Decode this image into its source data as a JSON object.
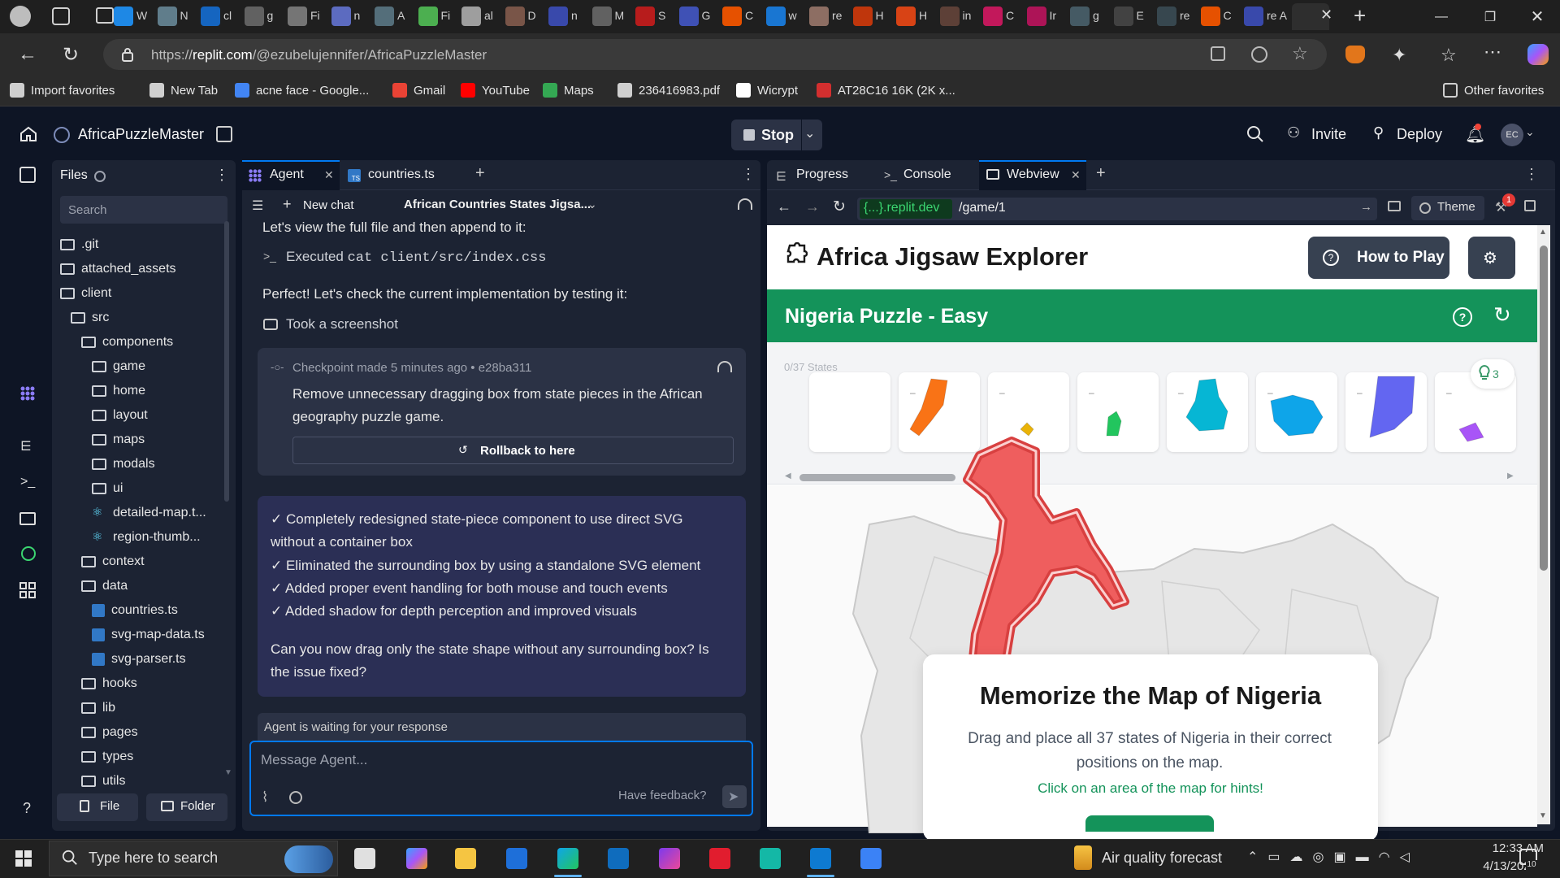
{
  "browser": {
    "tabs": [
      {
        "label": "W"
      },
      {
        "label": "N"
      },
      {
        "label": "cl"
      },
      {
        "label": "g"
      },
      {
        "label": "Fi"
      },
      {
        "label": "n"
      },
      {
        "label": "A"
      },
      {
        "label": "Fi"
      },
      {
        "label": "al"
      },
      {
        "label": "D"
      },
      {
        "label": "n"
      },
      {
        "label": "M"
      },
      {
        "label": "S"
      },
      {
        "label": "G"
      },
      {
        "label": "C"
      },
      {
        "label": "w"
      },
      {
        "label": "re"
      },
      {
        "label": "H"
      },
      {
        "label": "H"
      },
      {
        "label": "in"
      },
      {
        "label": "C"
      },
      {
        "label": "Ir"
      },
      {
        "label": "g"
      },
      {
        "label": "E"
      },
      {
        "label": "re"
      },
      {
        "label": "C"
      },
      {
        "label": "re A"
      }
    ],
    "url_prefix": "https://",
    "url_host": "replit.com",
    "url_path": "/@ezubelujennifer/AfricaPuzzleMaster",
    "favorites": [
      {
        "label": "Import favorites",
        "color": "#cfcfcf"
      },
      {
        "label": "New Tab",
        "color": "#cfcfcf"
      },
      {
        "label": "acne face - Google...",
        "color": "#4285f4"
      },
      {
        "label": "Gmail",
        "color": "#ea4335"
      },
      {
        "label": "YouTube",
        "color": "#ff0000"
      },
      {
        "label": "Maps",
        "color": "#34a853"
      },
      {
        "label": "236416983.pdf",
        "color": "#cfcfcf"
      },
      {
        "label": "Wicrypt",
        "color": "#ffffff"
      },
      {
        "label": "AT28C16 16K (2K x...",
        "color": "#d32f2f"
      }
    ],
    "other_favorites": "Other favorites"
  },
  "replit": {
    "project_name": "AfricaPuzzleMaster",
    "stop_label": "Stop",
    "invite_label": "Invite",
    "deploy_label": "Deploy",
    "avatar_initials": "EC"
  },
  "files": {
    "title": "Files",
    "search_placeholder": "Search",
    "tree": [
      {
        "label": ".git",
        "indent": 0,
        "kind": "folder"
      },
      {
        "label": "attached_assets",
        "indent": 0,
        "kind": "folder"
      },
      {
        "label": "client",
        "indent": 0,
        "kind": "folder-open"
      },
      {
        "label": "src",
        "indent": 1,
        "kind": "folder-open"
      },
      {
        "label": "components",
        "indent": 2,
        "kind": "folder-open"
      },
      {
        "label": "game",
        "indent": 3,
        "kind": "folder"
      },
      {
        "label": "home",
        "indent": 3,
        "kind": "folder"
      },
      {
        "label": "layout",
        "indent": 3,
        "kind": "folder"
      },
      {
        "label": "maps",
        "indent": 3,
        "kind": "folder"
      },
      {
        "label": "modals",
        "indent": 3,
        "kind": "folder"
      },
      {
        "label": "ui",
        "indent": 3,
        "kind": "folder"
      },
      {
        "label": "detailed-map.t...",
        "indent": 3,
        "kind": "react"
      },
      {
        "label": "region-thumb...",
        "indent": 3,
        "kind": "react"
      },
      {
        "label": "context",
        "indent": 2,
        "kind": "folder"
      },
      {
        "label": "data",
        "indent": 2,
        "kind": "folder-open"
      },
      {
        "label": "countries.ts",
        "indent": 3,
        "kind": "ts"
      },
      {
        "label": "svg-map-data.ts",
        "indent": 3,
        "kind": "ts"
      },
      {
        "label": "svg-parser.ts",
        "indent": 3,
        "kind": "ts"
      },
      {
        "label": "hooks",
        "indent": 2,
        "kind": "folder"
      },
      {
        "label": "lib",
        "indent": 2,
        "kind": "folder"
      },
      {
        "label": "pages",
        "indent": 2,
        "kind": "folder"
      },
      {
        "label": "types",
        "indent": 2,
        "kind": "folder"
      },
      {
        "label": "utils",
        "indent": 2,
        "kind": "folder"
      }
    ],
    "new_file": "File",
    "new_folder": "Folder"
  },
  "agent": {
    "tab_agent": "Agent",
    "tab_file": "countries.ts",
    "new_chat": "New chat",
    "chat_title": "African Countries States Jigsa...",
    "msg1": "Let's view the full file and then append to it:",
    "executed_prefix": "Executed ",
    "executed_cmd": "cat client/src/index.css",
    "msg2": "Perfect! Let's check the current implementation by testing it:",
    "screenshot": "Took a screenshot",
    "checkpoint_meta": "Checkpoint made 5 minutes ago • e28ba311",
    "checkpoint_text_1": "Remove unnecessary dragging box from state pieces in the African",
    "checkpoint_text_2": "geography puzzle game.",
    "rollback": "Rollback to here",
    "summary_lines": [
      "✓ Completely redesigned state-piece component to use direct SVG",
      "without a container box",
      "✓ Eliminated the surrounding box by using a standalone SVG element",
      "✓ Added proper event handling for both mouse and touch events",
      "✓ Added shadow for depth perception and improved visuals"
    ],
    "question_1": "Can you now drag only the state shape without any surrounding box? Is",
    "question_2": "the issue fixed?",
    "waiting": "Agent is waiting for your response",
    "message_placeholder": "Message Agent...",
    "feedback": "Have feedback?"
  },
  "right": {
    "tab_progress": "Progress",
    "tab_console": "Console",
    "tab_webview": "Webview",
    "domain": "{...}.replit.dev",
    "path": "/game/1",
    "theme": "Theme",
    "badge": "1"
  },
  "game": {
    "title": "Africa Jigsaw Explorer",
    "how_to_play": "How to Play",
    "puzzle_title": "Nigeria Puzzle - Easy",
    "states_count": "0/37 States",
    "hint_count": "3",
    "piece_dash": "–",
    "pieces": [
      {
        "color": "none"
      },
      {
        "color": "#f97316"
      },
      {
        "color": "#eab308"
      },
      {
        "color": "#22c55e"
      },
      {
        "color": "#06b6d4"
      },
      {
        "color": "#0ea5e9"
      },
      {
        "color": "#6366f1"
      },
      {
        "color": "#a855f7"
      }
    ],
    "memo_title": "Memorize the Map of Nigeria",
    "memo_desc": "Drag and place all 37 states of Nigeria in their correct positions on the map.",
    "memo_hint": "Click on an area of the map for hints!"
  },
  "taskbar": {
    "search_placeholder": "Type here to search",
    "air_quality": "Air quality forecast",
    "time": "12:33 AM",
    "date": "4/13/2025",
    "notif_count": "10"
  }
}
